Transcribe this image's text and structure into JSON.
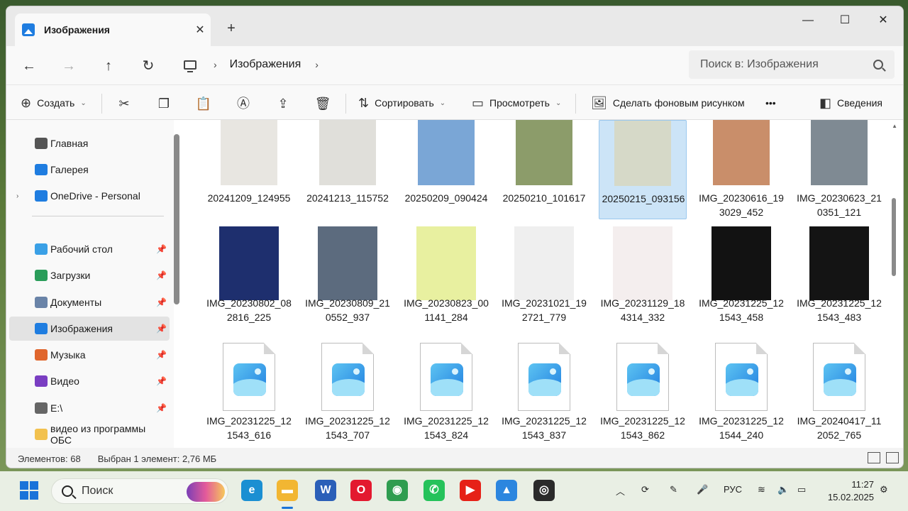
{
  "window": {
    "tab_title": "Изображения",
    "tab_close": "✕",
    "new_tab": "+",
    "minimize": "—",
    "maximize": "☐",
    "close": "✕"
  },
  "nav": {
    "back": "←",
    "forward": "→",
    "up": "↑",
    "refresh": "↻",
    "breadcrumb": [
      "Изображения"
    ],
    "search_placeholder": "Поиск в: Изображения"
  },
  "commands": {
    "create": "Создать",
    "sort": "Сортировать",
    "view": "Просмотреть",
    "set_wallpaper": "Сделать фоновым рисунком",
    "more": "•••",
    "details": "Сведения"
  },
  "sidebar": {
    "items": [
      {
        "label": "Главная",
        "icon": "home-icon",
        "color": "#555555"
      },
      {
        "label": "Галерея",
        "icon": "gallery-icon",
        "color": "#1f7de0"
      },
      {
        "label": "OneDrive - Personal",
        "icon": "cloud-icon",
        "color": "#1f7de0",
        "expandable": true
      },
      {
        "label": "Рабочий стол",
        "icon": "desktop-icon",
        "color": "#3aa0e6",
        "pinned": true
      },
      {
        "label": "Загрузки",
        "icon": "download-icon",
        "color": "#2a9d5a",
        "pinned": true
      },
      {
        "label": "Документы",
        "icon": "documents-icon",
        "color": "#6a84a8",
        "pinned": true
      },
      {
        "label": "Изображения",
        "icon": "pictures-icon",
        "color": "#1f7de0",
        "pinned": true,
        "selected": true
      },
      {
        "label": "Музыка",
        "icon": "music-icon",
        "color": "#e0662d",
        "pinned": true
      },
      {
        "label": "Видео",
        "icon": "video-icon",
        "color": "#7a3ec2",
        "pinned": true
      },
      {
        "label": "E:\\",
        "icon": "drive-icon",
        "color": "#666666",
        "pinned": true
      },
      {
        "label": "видео из программы ОБС",
        "icon": "folder-icon",
        "color": "#f2c14e"
      }
    ]
  },
  "files": [
    {
      "name": "20241209_124955",
      "kind": "photo",
      "color": "#e8e6e1"
    },
    {
      "name": "20241213_115752",
      "kind": "photo",
      "color": "#e0dfda"
    },
    {
      "name": "20250209_090424",
      "kind": "photo",
      "color": "#7aa6d6"
    },
    {
      "name": "20250210_101617",
      "kind": "photo",
      "color": "#8c9c6a"
    },
    {
      "name": "20250215_093156",
      "kind": "photo",
      "color": "#d6d9c8",
      "selected": true
    },
    {
      "name": "IMG_20230616_193029_452",
      "kind": "photo",
      "color": "#c98e6a"
    },
    {
      "name": "IMG_20230623_210351_121",
      "kind": "photo",
      "color": "#7f8a93"
    },
    {
      "name": "IMG_20230802_082816_225",
      "kind": "photo",
      "color": "#1e2f6e"
    },
    {
      "name": "IMG_20230809_210552_937",
      "kind": "photo",
      "color": "#5c6b7e"
    },
    {
      "name": "IMG_20230823_001141_284",
      "kind": "photo",
      "color": "#e8f0a0"
    },
    {
      "name": "IMG_20231021_192721_779",
      "kind": "photo",
      "color": "#efefef"
    },
    {
      "name": "IMG_20231129_184314_332",
      "kind": "photo",
      "color": "#f4eeee"
    },
    {
      "name": "IMG_20231225_121543_458",
      "kind": "photo",
      "color": "#121212"
    },
    {
      "name": "IMG_20231225_121543_483",
      "kind": "photo",
      "color": "#141414"
    },
    {
      "name": "IMG_20231225_121543_616",
      "kind": "generic"
    },
    {
      "name": "IMG_20231225_121543_707",
      "kind": "generic"
    },
    {
      "name": "IMG_20231225_121543_824",
      "kind": "generic"
    },
    {
      "name": "IMG_20231225_121543_837",
      "kind": "generic"
    },
    {
      "name": "IMG_20231225_121543_862",
      "kind": "generic"
    },
    {
      "name": "IMG_20231225_121544_240",
      "kind": "generic"
    },
    {
      "name": "IMG_20240417_112052_765",
      "kind": "generic"
    }
  ],
  "status": {
    "count": "Элементов: 68",
    "selection": "Выбран 1 элемент: 2,76 МБ"
  },
  "taskbar": {
    "search_placeholder": "Поиск",
    "apps": [
      {
        "name": "edge-icon",
        "color": "#1b8fd2",
        "glyph": "e"
      },
      {
        "name": "file-explorer-icon",
        "color": "#f2b632",
        "glyph": "▬",
        "active": true
      },
      {
        "name": "word-icon",
        "color": "#2b5fb8",
        "glyph": "W"
      },
      {
        "name": "opera-icon",
        "color": "#e3192f",
        "glyph": "O"
      },
      {
        "name": "chrome-icon",
        "color": "#2f9d50",
        "glyph": "◉"
      },
      {
        "name": "whatsapp-icon",
        "color": "#25c25a",
        "glyph": "✆"
      },
      {
        "name": "youtube-icon",
        "color": "#e62117",
        "glyph": "▶"
      },
      {
        "name": "photos-icon",
        "color": "#2c86df",
        "glyph": "▲"
      },
      {
        "name": "obs-icon",
        "color": "#2a2a2a",
        "glyph": "◎"
      }
    ],
    "lang": "РУС",
    "time": "11:27",
    "date": "15.02.2025"
  }
}
